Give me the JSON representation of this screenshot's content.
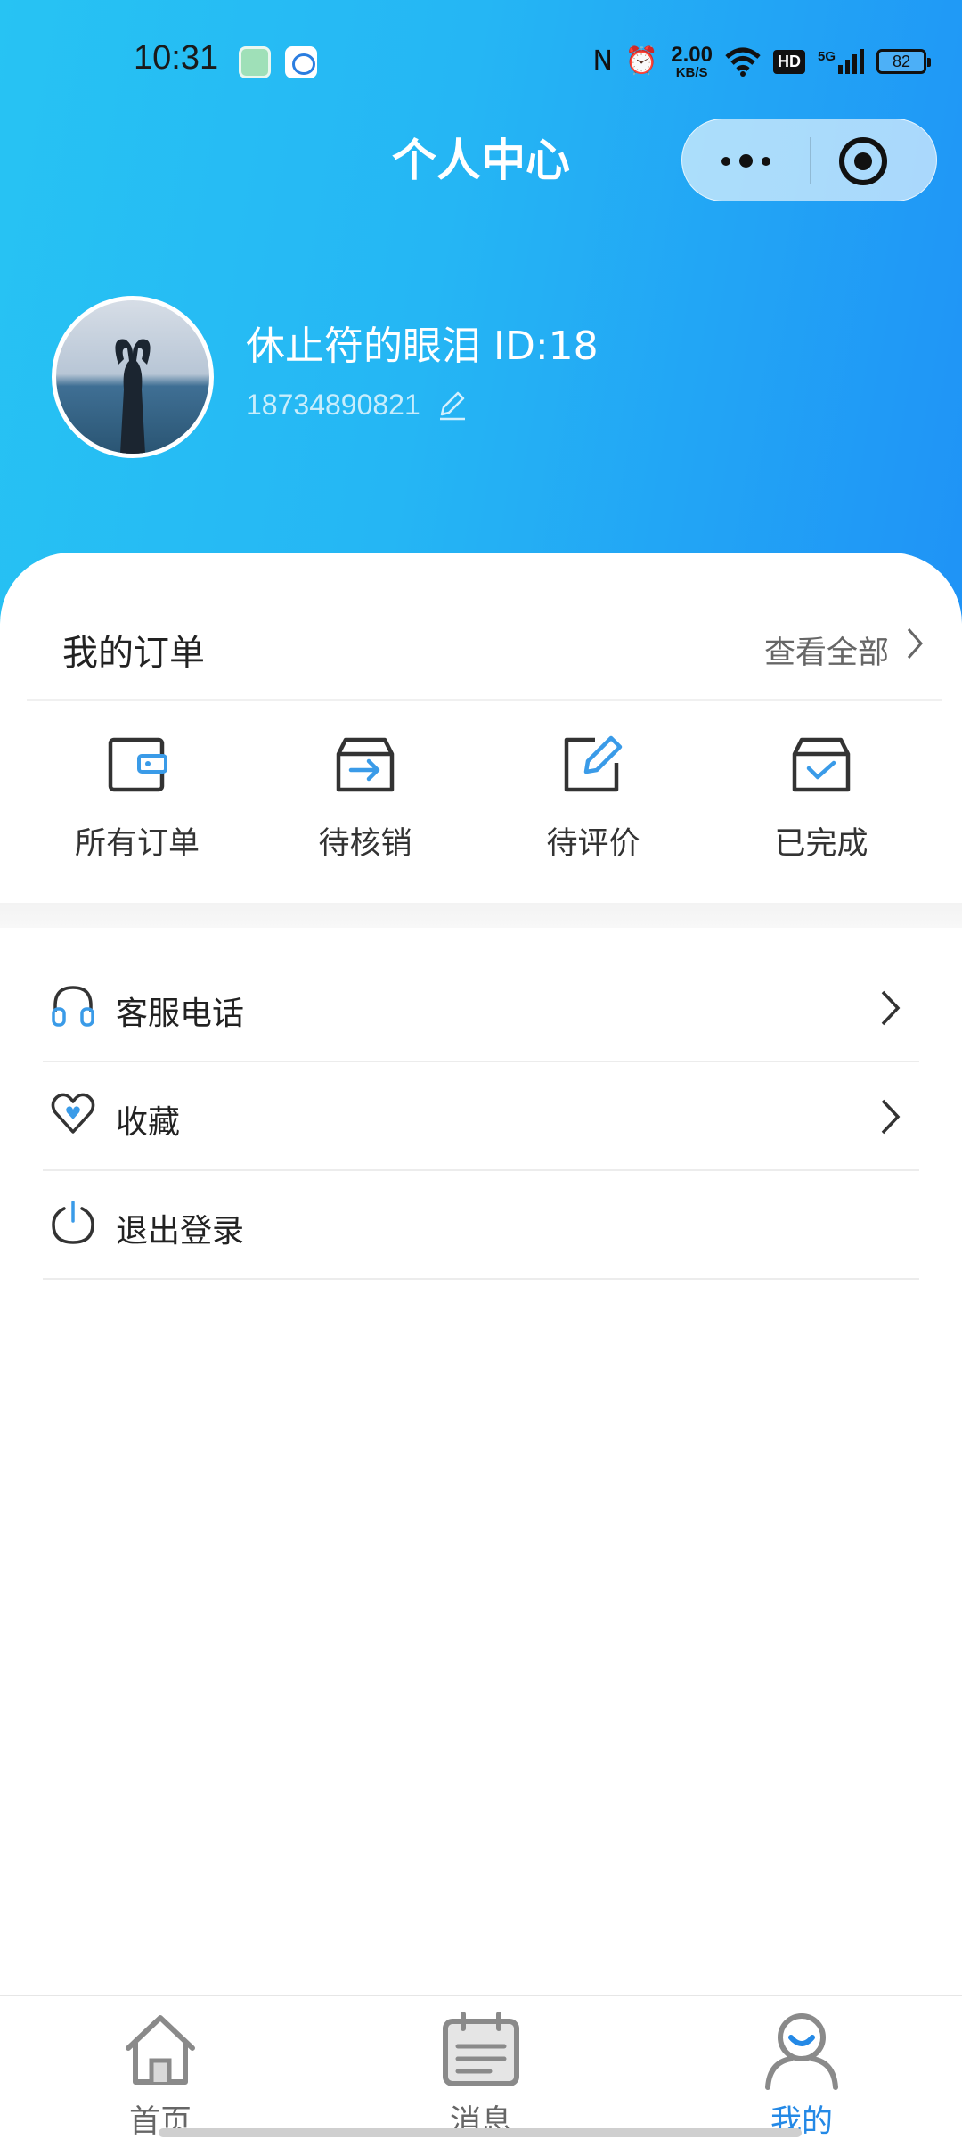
{
  "status_bar": {
    "time": "10:31",
    "net_speed_value": "2.00",
    "net_speed_unit": "KB/S",
    "network_type": "5G",
    "hd_badge": "HD",
    "battery": "82"
  },
  "header": {
    "title": "个人中心"
  },
  "profile": {
    "nickname": "休止符的眼泪 ID:18",
    "phone": "18734890821"
  },
  "orders": {
    "title": "我的订单",
    "view_all": "查看全部",
    "items": [
      {
        "label": "所有订单",
        "icon": "wallet-icon"
      },
      {
        "label": "待核销",
        "icon": "box-arrow-icon"
      },
      {
        "label": "待评价",
        "icon": "edit-review-icon"
      },
      {
        "label": "已完成",
        "icon": "box-check-icon"
      }
    ]
  },
  "menu": {
    "items": [
      {
        "label": "客服电话",
        "icon": "headset-icon",
        "has_chevron": true
      },
      {
        "label": "收藏",
        "icon": "heart-icon",
        "has_chevron": true
      },
      {
        "label": "退出登录",
        "icon": "power-icon",
        "has_chevron": false
      }
    ]
  },
  "tabbar": {
    "items": [
      {
        "label": "首页",
        "icon": "home-icon",
        "active": false
      },
      {
        "label": "消息",
        "icon": "message-icon",
        "active": false
      },
      {
        "label": "我的",
        "icon": "profile-icon",
        "active": true
      }
    ]
  },
  "colors": {
    "header_gradient_start": "#27c3f3",
    "header_gradient_end": "#1f93f6",
    "accent": "#2489e6",
    "icon_blue": "#3a9be8"
  }
}
